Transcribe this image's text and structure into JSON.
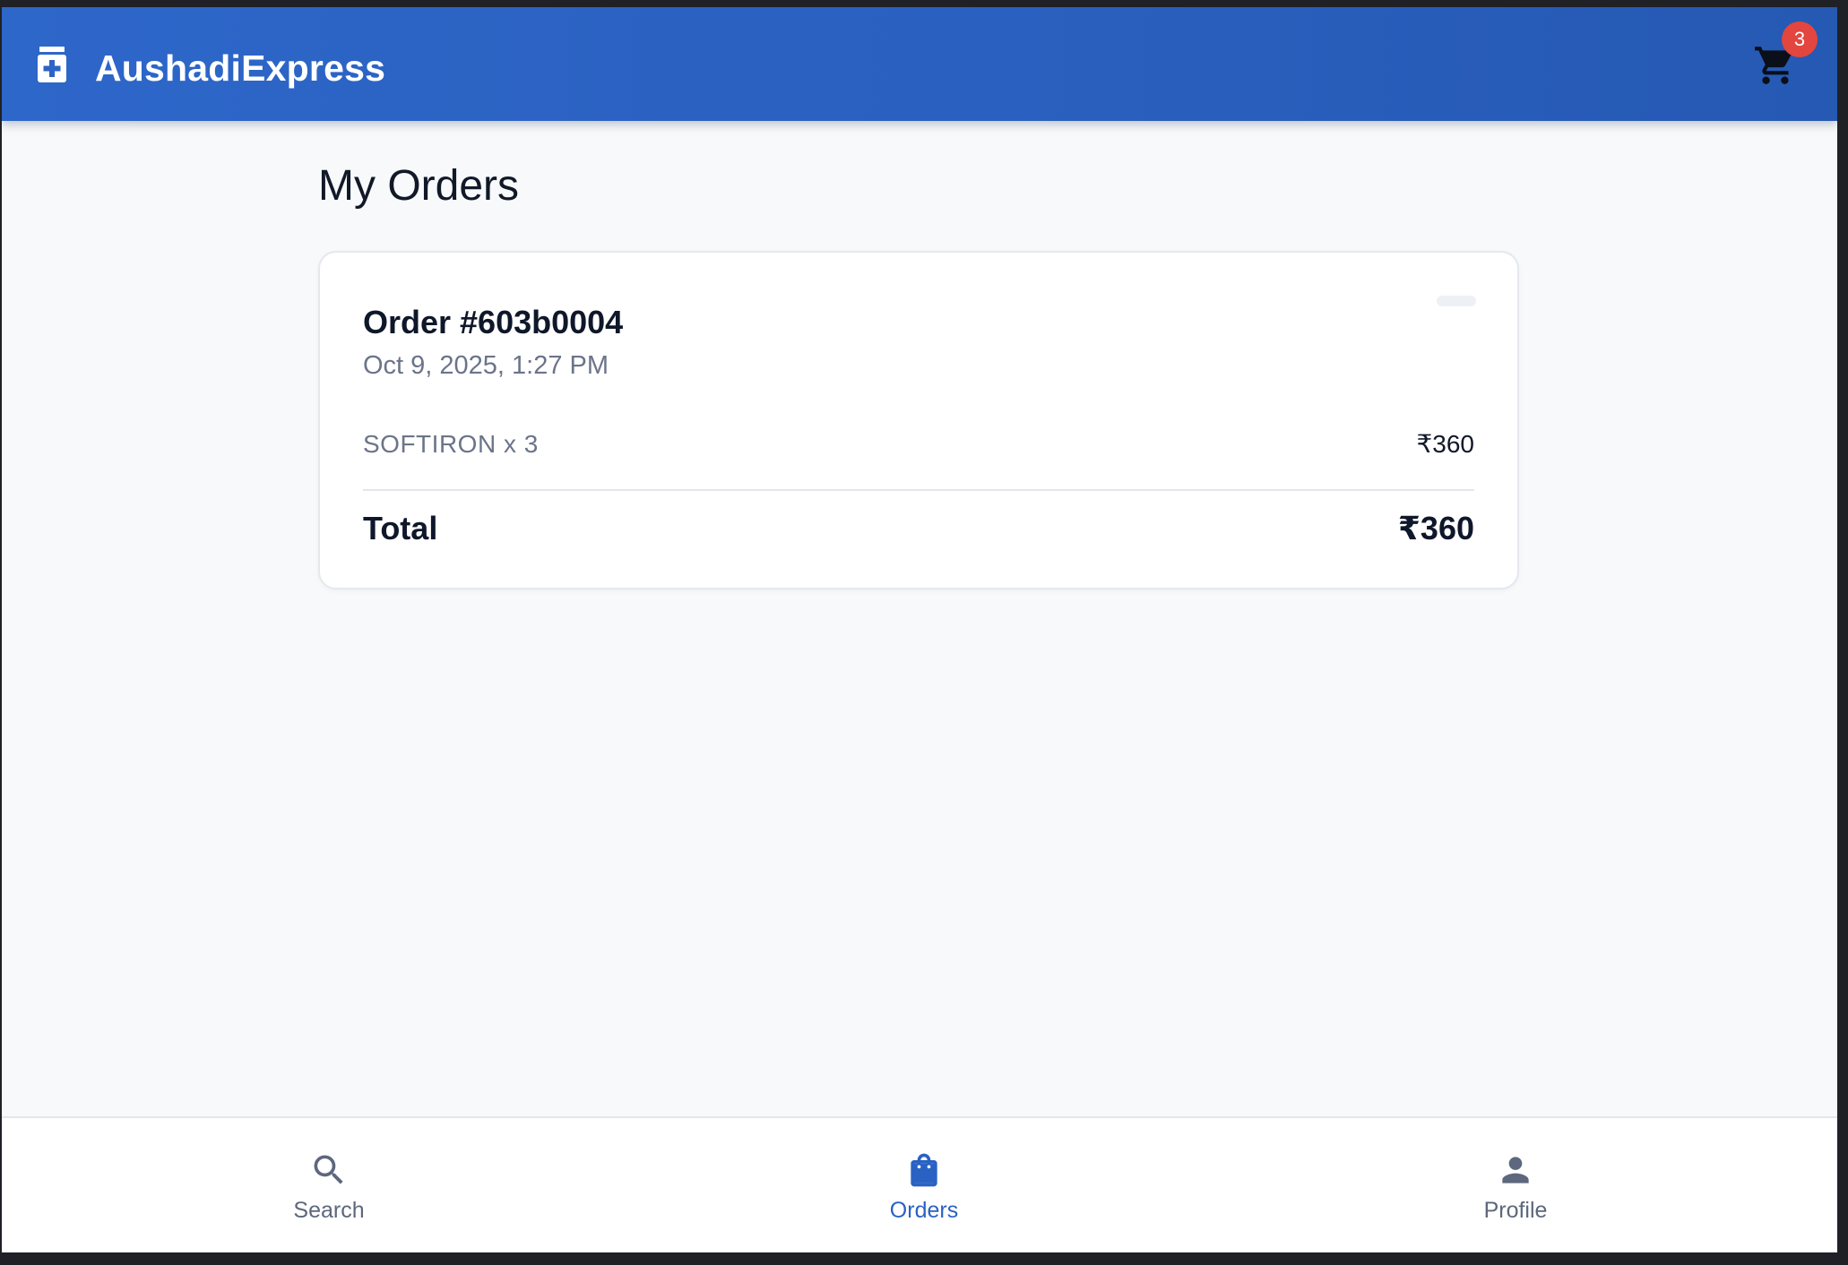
{
  "app": {
    "title": "AushadiExpress",
    "cart_count": "3",
    "brand_color": "#2a62c4",
    "badge_color": "#e2463f"
  },
  "page": {
    "title": "My Orders"
  },
  "orders": [
    {
      "title": "Order #603b0004",
      "date": "Oct 9, 2025, 1:27 PM",
      "items": [
        {
          "name": "SOFTIRON x 3",
          "price": "₹360"
        }
      ],
      "total_label": "Total",
      "total_value": "₹360"
    }
  ],
  "nav": {
    "items": [
      {
        "label": "Search",
        "icon": "search-icon",
        "active": false
      },
      {
        "label": "Orders",
        "icon": "shopping-bag-icon",
        "active": true
      },
      {
        "label": "Profile",
        "icon": "person-icon",
        "active": false
      }
    ]
  }
}
